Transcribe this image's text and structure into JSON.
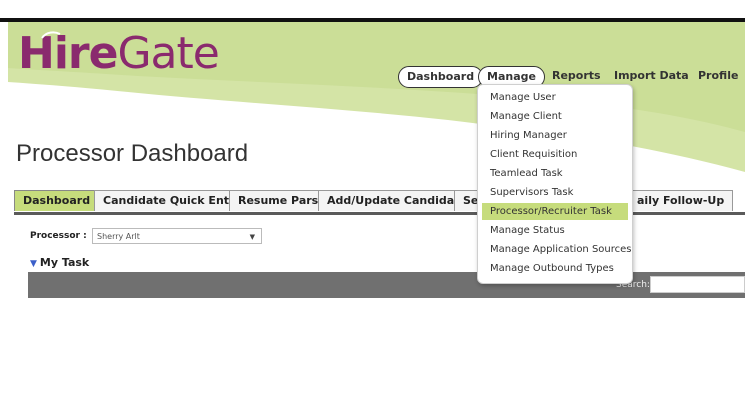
{
  "brand": {
    "logo_hire": "Hire",
    "logo_gate": "Gate",
    "colors": {
      "brand": "#8a2a6e",
      "accent": "#c6dc7c"
    }
  },
  "nav": {
    "items": [
      {
        "label": "Dashboard"
      },
      {
        "label": "Manage"
      },
      {
        "label": "Reports"
      },
      {
        "label": "Import Data"
      },
      {
        "label": "Profile"
      }
    ]
  },
  "page": {
    "title": "Processor Dashboard"
  },
  "tabs": [
    {
      "label": "Dashboard"
    },
    {
      "label": "Candidate Quick Entry"
    },
    {
      "label": "Resume Parse"
    },
    {
      "label": "Add/Update Candidate"
    },
    {
      "label": "Sea"
    },
    {
      "label": "aily Follow-Up"
    }
  ],
  "processor": {
    "label": "Processor :",
    "value": "Sherry Arlt",
    "arrow": "▼"
  },
  "mytask": {
    "label": "My Task"
  },
  "search": {
    "label": "Search:"
  },
  "manage_menu": {
    "items": [
      {
        "label": "Manage User"
      },
      {
        "label": "Manage Client"
      },
      {
        "label": "Hiring Manager"
      },
      {
        "label": "Client Requisition"
      },
      {
        "label": "Teamlead Task"
      },
      {
        "label": "Supervisors Task"
      },
      {
        "label": "Processor/Recruiter Task"
      },
      {
        "label": "Manage Status"
      },
      {
        "label": "Manage Application Sources"
      },
      {
        "label": "Manage Outbound Types"
      }
    ]
  }
}
